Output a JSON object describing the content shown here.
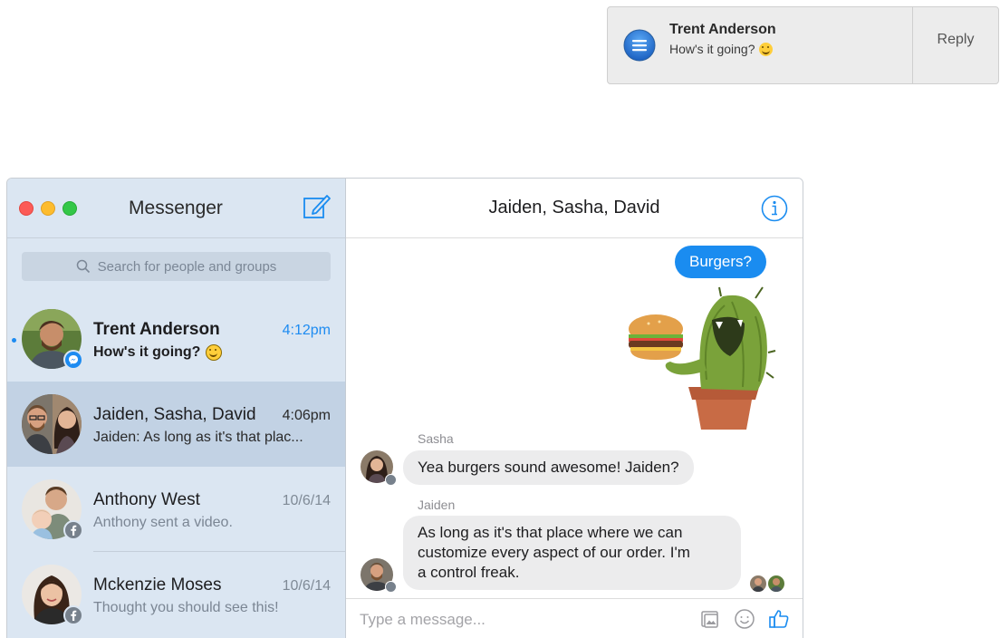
{
  "notification": {
    "title": "Trent Anderson",
    "message": "How's it going?",
    "reply_label": "Reply",
    "app_icon": "messages-app-icon"
  },
  "window": {
    "sidebar": {
      "title": "Messenger",
      "compose_icon": "compose-icon",
      "search_placeholder": "Search for people and groups",
      "conversations": [
        {
          "name": "Trent Anderson",
          "time": "4:12pm",
          "preview": "How's it going?",
          "unread": true,
          "badge": "messenger"
        },
        {
          "name": "Jaiden, Sasha, David",
          "time": "4:06pm",
          "preview": "Jaiden: As long as it's that plac...",
          "selected": true
        },
        {
          "name": "Anthony West",
          "time": "10/6/14",
          "preview": "Anthony sent a video.",
          "badge": "facebook"
        },
        {
          "name": "Mckenzie Moses",
          "time": "10/6/14",
          "preview": "Thought you should see this!",
          "badge": "facebook"
        }
      ]
    },
    "chat": {
      "title": "Jaiden, Sasha, David",
      "info_icon": "info-icon",
      "messages": [
        {
          "direction": "outgoing",
          "text": "Burgers?"
        },
        {
          "direction": "outgoing",
          "type": "sticker",
          "sticker": "cactus-eating-burger"
        },
        {
          "direction": "incoming",
          "sender": "Sasha",
          "text": "Yea burgers sound awesome! Jaiden?"
        },
        {
          "direction": "incoming",
          "sender": "Jaiden",
          "text_lines": [
            "As long as it's that place where we can",
            "customize every aspect of our order. I'm",
            "a control freak."
          ]
        }
      ],
      "composer_placeholder": "Type a message...",
      "composer_icons": [
        "photo-icon",
        "emoji-icon",
        "like-icon"
      ]
    }
  },
  "colors": {
    "accent": "#1a8cf0",
    "sidebar_bg": "#dbe6f2",
    "selected_bg": "#c2d2e4",
    "incoming_bubble": "#ececed"
  }
}
